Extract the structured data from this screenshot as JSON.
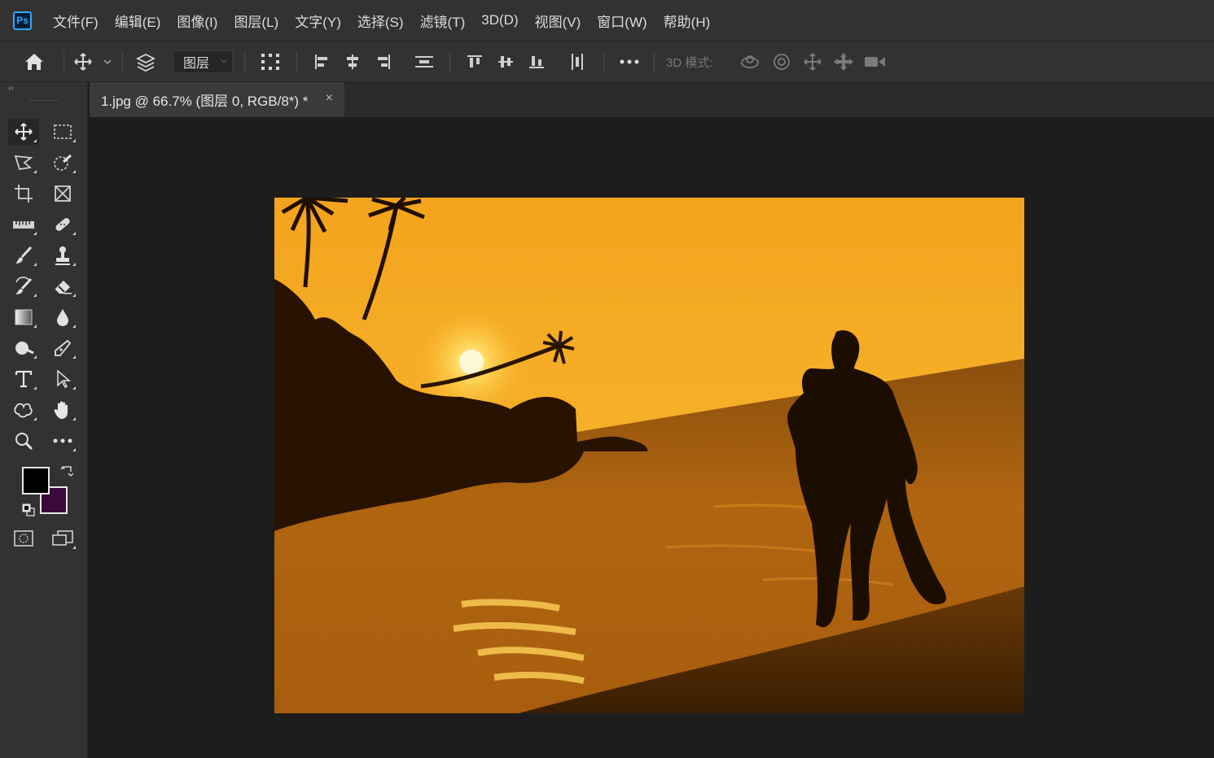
{
  "app": {
    "logo_text": "Ps"
  },
  "menu": [
    {
      "label": "文件(F)"
    },
    {
      "label": "编辑(E)"
    },
    {
      "label": "图像(I)"
    },
    {
      "label": "图层(L)"
    },
    {
      "label": "文字(Y)"
    },
    {
      "label": "选择(S)"
    },
    {
      "label": "滤镜(T)"
    },
    {
      "label": "3D(D)"
    },
    {
      "label": "视图(V)"
    },
    {
      "label": "窗口(W)"
    },
    {
      "label": "帮助(H)"
    }
  ],
  "options_bar": {
    "auto_select_value": "图层",
    "mode_3d_label": "3D 模式:",
    "icons": [
      "home-icon",
      "move-tool-icon",
      "auto-select-icon",
      "transform-controls-icon",
      "align-left-icon",
      "align-h-center-icon",
      "align-right-icon",
      "distribute-vertical-icon",
      "align-top-icon",
      "align-v-center-icon",
      "align-bottom-icon",
      "distribute-horizontal-icon",
      "more-options-icon",
      "orbit-3d-icon",
      "roll-3d-icon",
      "drag-3d-icon",
      "slide-3d-icon",
      "scale-3d-icon"
    ]
  },
  "document": {
    "tab_title": "1.jpg @ 66.7% (图层 0, RGB/8*) *",
    "close_glyph": "×"
  },
  "toolbar": {
    "collapse_glyph": "‹‹",
    "tools": [
      "move-tool",
      "rectangular-marquee-tool",
      "polygonal-lasso-tool",
      "quick-selection-tool",
      "crop-tool",
      "frame-tool",
      "ruler-tool",
      "healing-brush-tool",
      "brush-tool",
      "clone-stamp-tool",
      "history-brush-tool",
      "eraser-tool",
      "gradient-tool",
      "blur-tool",
      "dodge-tool",
      "pen-tool",
      "type-tool",
      "path-selection-tool",
      "custom-shape-tool",
      "hand-tool",
      "zoom-tool",
      "edit-toolbar"
    ],
    "foreground_color": "#000000",
    "background_color": "#3b0a3d"
  },
  "canvas": {
    "background": "#1d1d1d",
    "image_subject": "beach sunset with couple silhouette"
  }
}
